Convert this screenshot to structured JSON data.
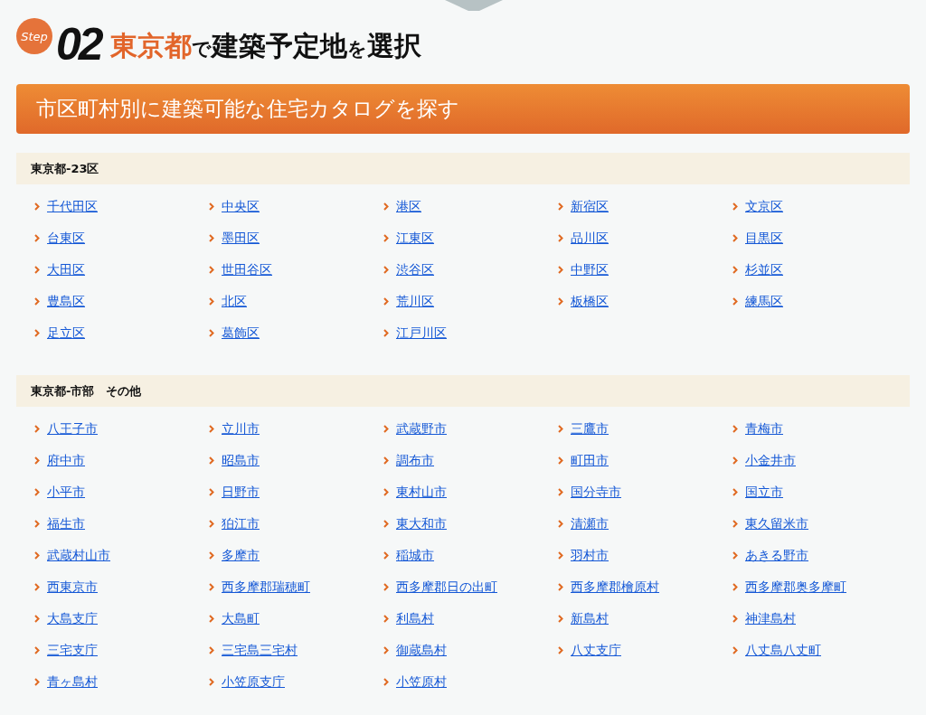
{
  "heading": {
    "badge": "Step",
    "number": "02",
    "parts": [
      {
        "text": "東京都",
        "kind": "accent"
      },
      {
        "text": "で",
        "kind": "small"
      },
      {
        "text": "建築予定地",
        "kind": "main"
      },
      {
        "text": "を",
        "kind": "small"
      },
      {
        "text": "選択",
        "kind": "main"
      }
    ]
  },
  "banner": "市区町村別に建築可能な住宅カタログを探す",
  "sections": [
    {
      "title": "東京都-23区",
      "links": [
        "千代田区",
        "中央区",
        "港区",
        "新宿区",
        "文京区",
        "台東区",
        "墨田区",
        "江東区",
        "品川区",
        "目黒区",
        "大田区",
        "世田谷区",
        "渋谷区",
        "中野区",
        "杉並区",
        "豊島区",
        "北区",
        "荒川区",
        "板橋区",
        "練馬区",
        "足立区",
        "葛飾区",
        "江戸川区"
      ]
    },
    {
      "title": "東京都-市部　その他",
      "links": [
        "八王子市",
        "立川市",
        "武蔵野市",
        "三鷹市",
        "青梅市",
        "府中市",
        "昭島市",
        "調布市",
        "町田市",
        "小金井市",
        "小平市",
        "日野市",
        "東村山市",
        "国分寺市",
        "国立市",
        "福生市",
        "狛江市",
        "東大和市",
        "清瀬市",
        "東久留米市",
        "武蔵村山市",
        "多摩市",
        "稲城市",
        "羽村市",
        "あきる野市",
        "西東京市",
        "西多摩郡瑞穂町",
        "西多摩郡日の出町",
        "西多摩郡檜原村",
        "西多摩郡奥多摩町",
        "大島支庁",
        "大島町",
        "利島村",
        "新島村",
        "神津島村",
        "三宅支庁",
        "三宅島三宅村",
        "御蔵島村",
        "八丈支庁",
        "八丈島八丈町",
        "青ヶ島村",
        "小笠原支庁",
        "小笠原村"
      ]
    }
  ]
}
